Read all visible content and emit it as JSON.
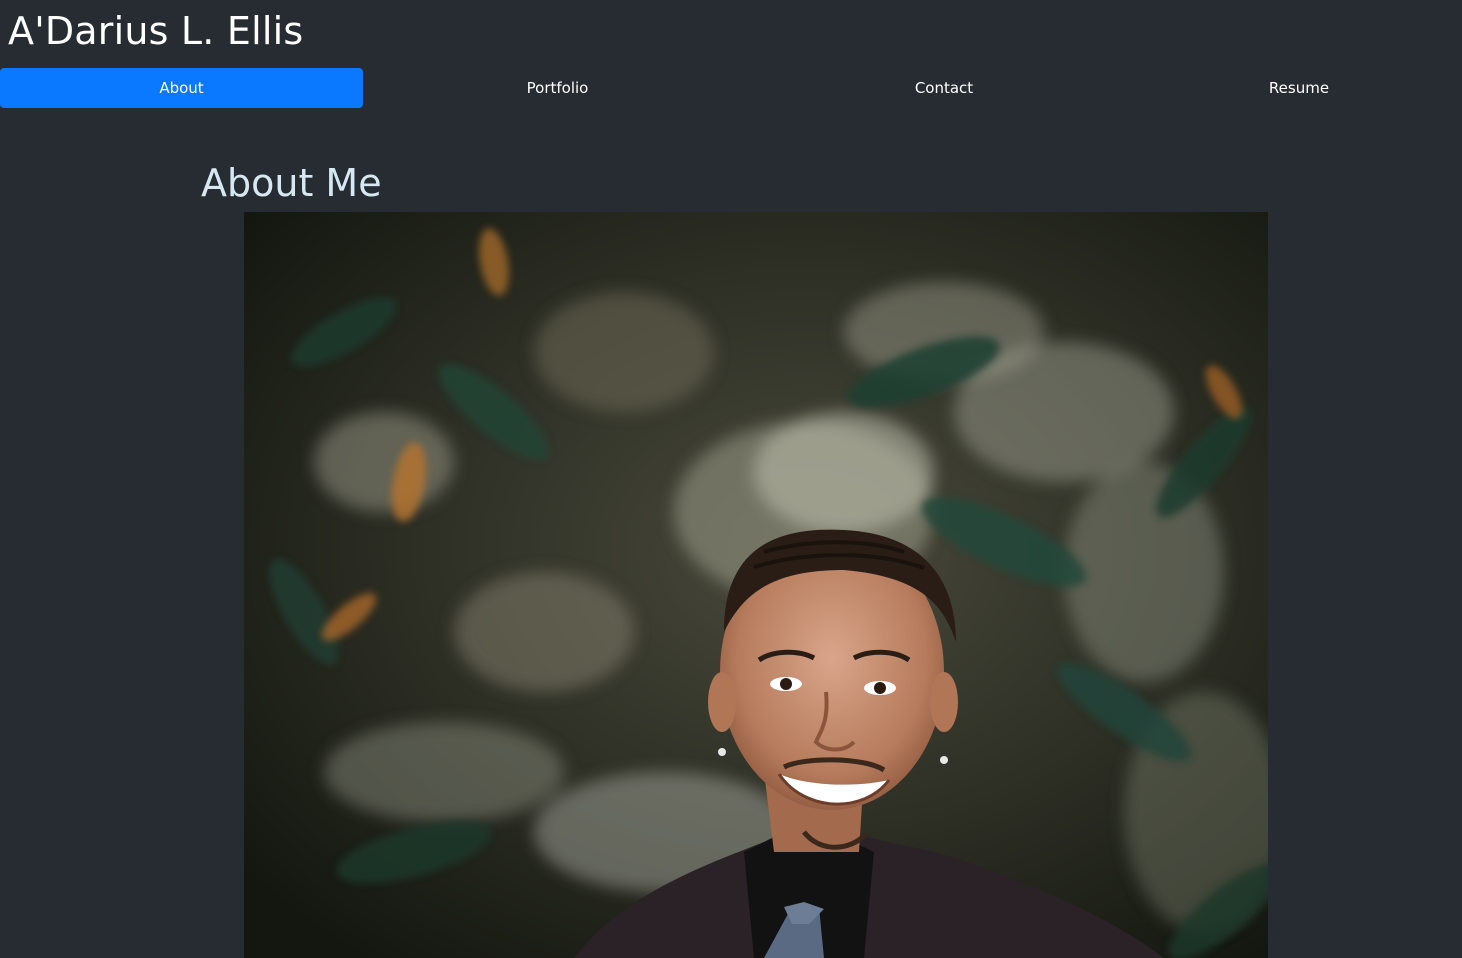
{
  "site": {
    "title": "A'Darius L. Ellis"
  },
  "nav": {
    "items": [
      {
        "label": "About",
        "active": true
      },
      {
        "label": "Portfolio",
        "active": false
      },
      {
        "label": "Contact",
        "active": false
      },
      {
        "label": "Resume",
        "active": false
      }
    ],
    "active_color": "#0a78ff"
  },
  "main": {
    "heading": "About Me"
  },
  "colors": {
    "background": "#262c32",
    "heading": "#d6e8f2"
  }
}
